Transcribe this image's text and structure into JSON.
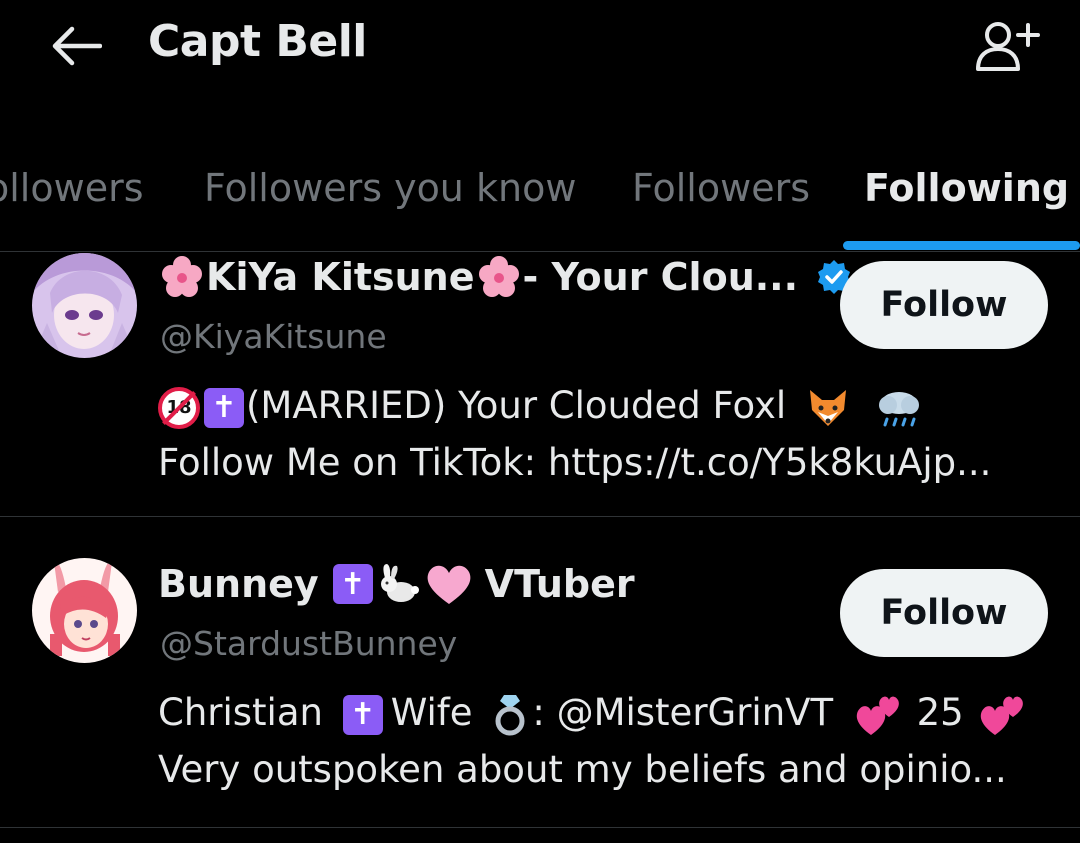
{
  "header": {
    "title": "Capt Bell"
  },
  "tabs": [
    {
      "label": "ollowers",
      "active": false
    },
    {
      "label": "Followers you know",
      "active": false
    },
    {
      "label": "Followers",
      "active": false
    },
    {
      "label": "Following",
      "active": true
    }
  ],
  "users": [
    {
      "name_prefix": "KiYa Kitsune",
      "name_suffix": " - Your Clou...",
      "verified": true,
      "handle": "@KiyaKitsune",
      "bio_line1": "(MARRIED) Your Clouded Foxl",
      "bio_line2": "Follow Me on TikTok: https://t.co/Y5k8kuAjp...",
      "follow_label": "Follow"
    },
    {
      "name_prefix": "Bunney",
      "name_suffix": "VTuber",
      "verified": false,
      "handle": "@StardustBunney",
      "bio_line1_a": "Christian",
      "bio_line1_b": "Wife",
      "bio_line1_c": ": @MisterGrinVT",
      "bio_line1_d": "25",
      "bio_line2": "Very outspoken about my beliefs and opinio...",
      "follow_label": "Follow"
    }
  ],
  "colors": {
    "accent": "#1d9bf0",
    "background": "#000000",
    "muted": "#71767b",
    "text": "#e7e9ea"
  }
}
